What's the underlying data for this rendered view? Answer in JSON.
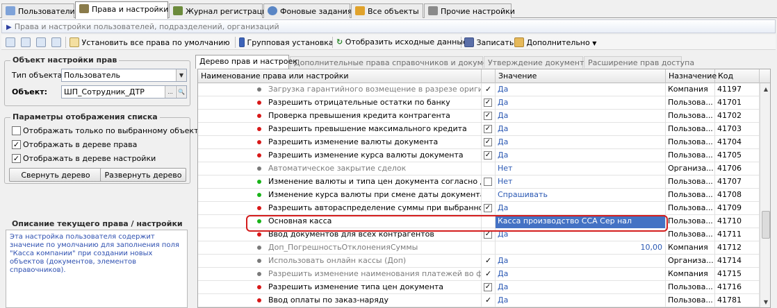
{
  "tabs": [
    {
      "label": "Пользователи",
      "icon": "users-icon"
    },
    {
      "label": "Права и настройки",
      "icon": "key-rights-icon"
    },
    {
      "label": "Журнал регистрации",
      "icon": "log-icon"
    },
    {
      "label": "Фоновые задания",
      "icon": "clock-icon"
    },
    {
      "label": "Все объекты",
      "icon": "objects-icon"
    },
    {
      "label": "Прочие настройки",
      "icon": "tools-icon"
    }
  ],
  "header": {
    "title": "Права и настройки пользователей, подразделений, организаций"
  },
  "toolbar": {
    "set_defaults": "Установить все права по умолчанию",
    "group_setup": "Групповая установка",
    "show_source": "Отобразить исходные данные",
    "save": "Записать",
    "more": "Дополнительно"
  },
  "object_group": {
    "title": "Объект настройки прав",
    "type_label": "Тип объекта:",
    "type_value": "Пользователь",
    "object_label": "Объект:",
    "object_value": "ШП_Сотрудник_ДТР"
  },
  "display_group": {
    "title": "Параметры отображения списка",
    "options": [
      {
        "label": "Отображать только по  выбранному объекту",
        "checked": false
      },
      {
        "label": "Отображать в дереве права",
        "checked": true
      },
      {
        "label": "Отображать в дереве настройки",
        "checked": true
      }
    ],
    "collapse": "Свернуть дерево",
    "expand": "Развернуть дерево"
  },
  "description": {
    "title": "Описание текущего права / настройки",
    "text": "Эта настройка пользователя содержит значение по умолчанию для заполнения поля \"Касса компании\" при создании новых объектов (документов, элементов справочников)."
  },
  "inner_tabs": [
    "Дерево прав и настроек",
    "Дополнительные права справочников и документов",
    "Утверждение документов",
    "Расширение прав доступа"
  ],
  "grid": {
    "columns": [
      "Наименование права или настройки",
      "Значение",
      "Назначение",
      "Код"
    ],
    "rows": [
      {
        "name": "Загрузка гарантийного возмещение в разрезе оригинал...",
        "dot": "gray",
        "check": "mark",
        "value": "Да",
        "assign": "Компания",
        "code": "41197",
        "dim": true
      },
      {
        "name": "Разрешить отрицательные остатки по банку",
        "dot": "red",
        "check": "box-checked",
        "value": "Да",
        "assign": "Пользова...",
        "code": "41701",
        "dim": false
      },
      {
        "name": "Проверка превышения кредита контрагента",
        "dot": "red",
        "check": "box-checked",
        "value": "Да",
        "assign": "Пользова...",
        "code": "41702",
        "dim": false
      },
      {
        "name": "Разрешить превышение максимального кредита",
        "dot": "red",
        "check": "box-checked",
        "value": "Да",
        "assign": "Пользова...",
        "code": "41703",
        "dim": false
      },
      {
        "name": "Разрешить изменение валюты документа",
        "dot": "red",
        "check": "box-checked",
        "value": "Да",
        "assign": "Пользова...",
        "code": "41704",
        "dim": false
      },
      {
        "name": "Разрешить изменение курса валюты документа",
        "dot": "red",
        "check": "box-checked",
        "value": "Да",
        "assign": "Пользова...",
        "code": "41705",
        "dim": false
      },
      {
        "name": "Автоматическое закрытие сделок",
        "dot": "gray",
        "check": "",
        "value": "Нет",
        "assign": "Организа...",
        "code": "41706",
        "dim": true
      },
      {
        "name": "Изменение валюты и типа цен документа согласно дого...",
        "dot": "green",
        "check": "box",
        "value": "Нет",
        "assign": "Пользова...",
        "code": "41707",
        "dim": false
      },
      {
        "name": "Изменение курса валюты при смене даты документа",
        "dot": "green",
        "check": "",
        "value": "Спрашивать",
        "assign": "Пользова...",
        "code": "41708",
        "dim": false
      },
      {
        "name": "Разрешить автораспределение суммы при выбранной с...",
        "dot": "red",
        "check": "box-checked",
        "value": "Да",
        "assign": "Пользова...",
        "code": "41709",
        "dim": false
      },
      {
        "name": "Основная касса",
        "dot": "green",
        "check": "",
        "value": "Касса производство ССА Сер нал",
        "assign": "Пользова...",
        "code": "41710",
        "dim": false,
        "selected": true
      },
      {
        "name": "Ввод документов для всех контрагентов",
        "dot": "red",
        "check": "box-checked",
        "value": "Да",
        "assign": "Пользова...",
        "code": "41711",
        "dim": false
      },
      {
        "name": "Доп_ПогрешностьОтклоненияСуммы",
        "dot": "gray",
        "check": "",
        "value": "10,00",
        "value_right": true,
        "assign": "Компания",
        "code": "41712",
        "dim": true
      },
      {
        "name": "Использовать онлайн кассы (Доп)",
        "dot": "gray",
        "check": "mark",
        "value": "Да",
        "assign": "Организа...",
        "code": "41714",
        "dim": true
      },
      {
        "name": "Разрешить изменение наименования платежей во фрон...",
        "dot": "gray",
        "check": "mark",
        "value": "Да",
        "assign": "Компания",
        "code": "41715",
        "dim": true
      },
      {
        "name": "Разрешить изменение типа цен документа",
        "dot": "red",
        "check": "box-checked",
        "value": "Да",
        "assign": "Пользова...",
        "code": "41716",
        "dim": false
      },
      {
        "name": "Ввод оплаты по заказ-наряду",
        "dot": "red",
        "check": "mark",
        "value": "Да",
        "assign": "Пользова...",
        "code": "41781",
        "dim": false
      }
    ]
  },
  "colors": {
    "red": "#d81818",
    "green": "#19b419",
    "gray": "#7a7a7a",
    "value_blue": "#2a58b3",
    "selected": "#4472c4",
    "highlight": "#d41c1c"
  }
}
